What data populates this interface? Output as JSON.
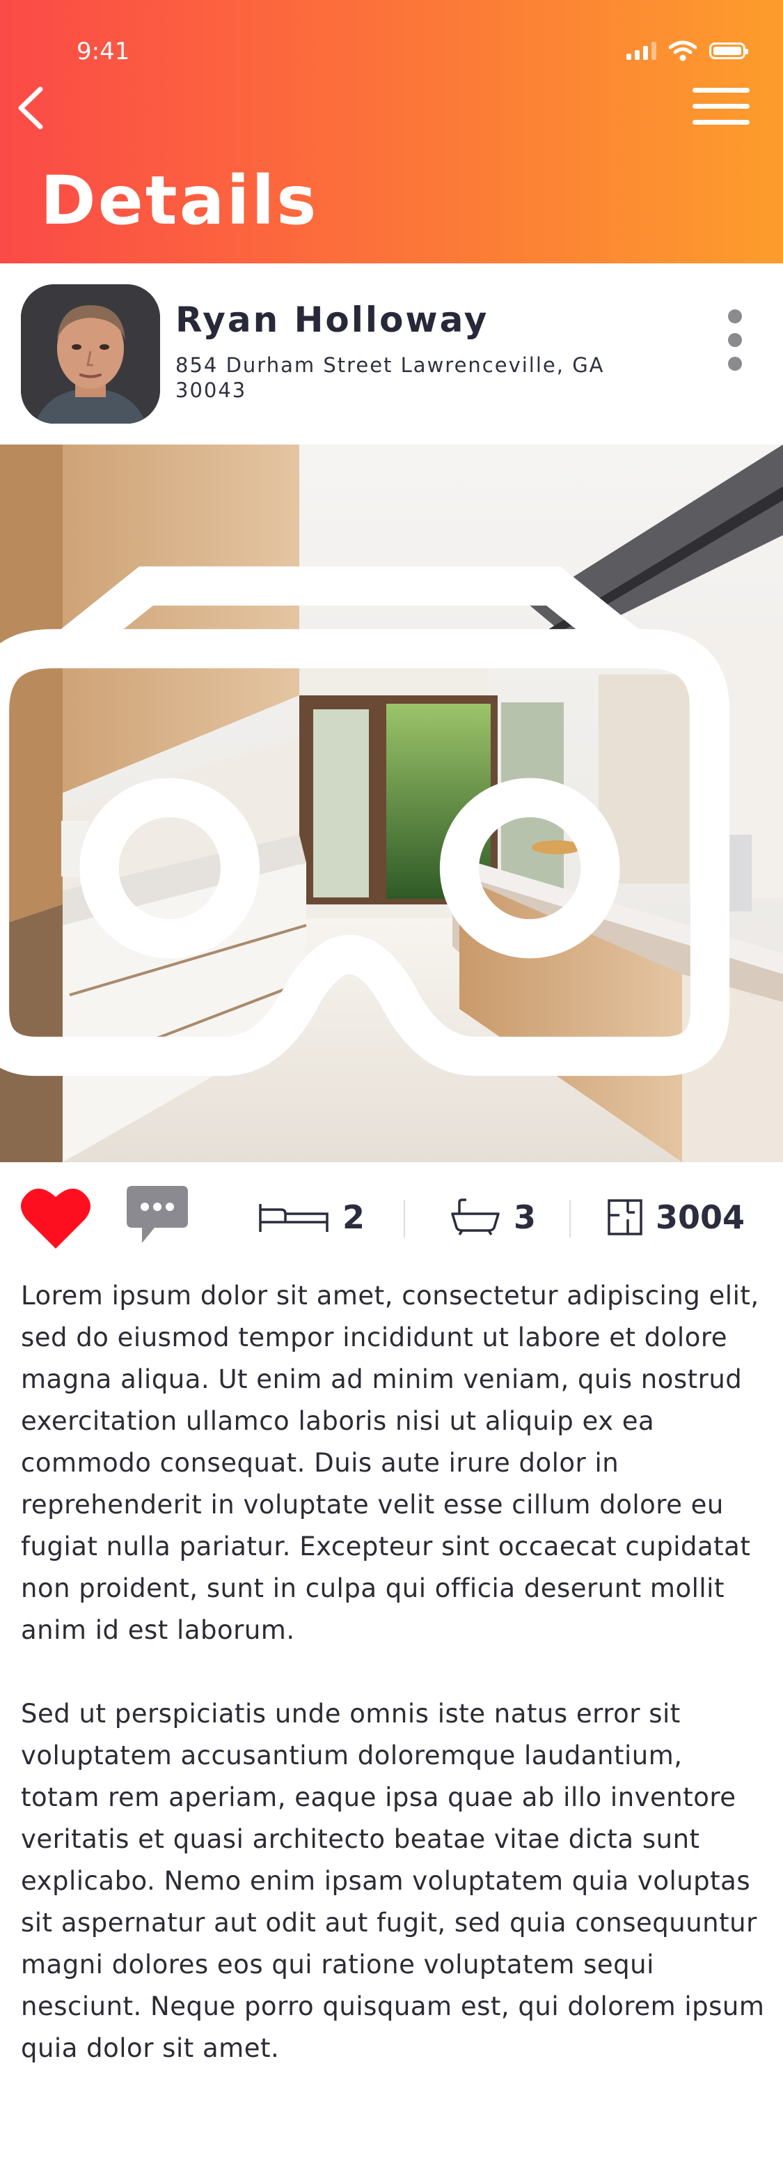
{
  "status_bar": {
    "time": "9:41"
  },
  "header": {
    "title": "Details"
  },
  "agent": {
    "name": "Ryan Holloway",
    "address": "854 Durham Street Lawrenceville, GA 30043"
  },
  "stats": {
    "bedrooms": "2",
    "bathrooms": "3",
    "area": "3004"
  },
  "description": {
    "paragraph_1": "Lorem ipsum dolor sit amet, consectetur adipiscing elit, sed do eiusmod tempor incididunt ut labore et dolore magna aliqua. Ut enim ad minim veniam, quis nostrud exercitation ullamco laboris nisi ut aliquip ex ea commodo consequat. Duis aute irure dolor in reprehenderit in voluptate velit esse cillum dolore eu fugiat nulla pariatur. Excepteur sint occaecat cupidatat non proident, sunt in culpa qui officia deserunt mollit anim id est laborum.",
    "paragraph_2": "Sed ut perspiciatis unde omnis iste natus error sit voluptatem accusantium doloremque laudantium, totam rem aperiam, eaque ipsa quae ab illo inventore veritatis et quasi architecto beatae vitae dicta sunt explicabo. Nemo enim ipsam voluptatem quia voluptas sit aspernatur aut odit aut fugit, sed quia consequuntur magni dolores eos qui ratione voluptatem sequi nesciunt. Neque porro quisquam est, qui dolorem ipsum quia dolor sit amet."
  },
  "colors": {
    "gradient_start": "#fb4a47",
    "gradient_end": "#fd9d2c",
    "heart": "#fe0f1f"
  },
  "icons": [
    "back-arrow-icon",
    "hamburger-menu-icon",
    "more-vertical-icon",
    "vr-headset-icon",
    "heart-icon",
    "chat-bubble-icon",
    "bed-icon",
    "bathtub-icon",
    "floor-plan-icon"
  ]
}
